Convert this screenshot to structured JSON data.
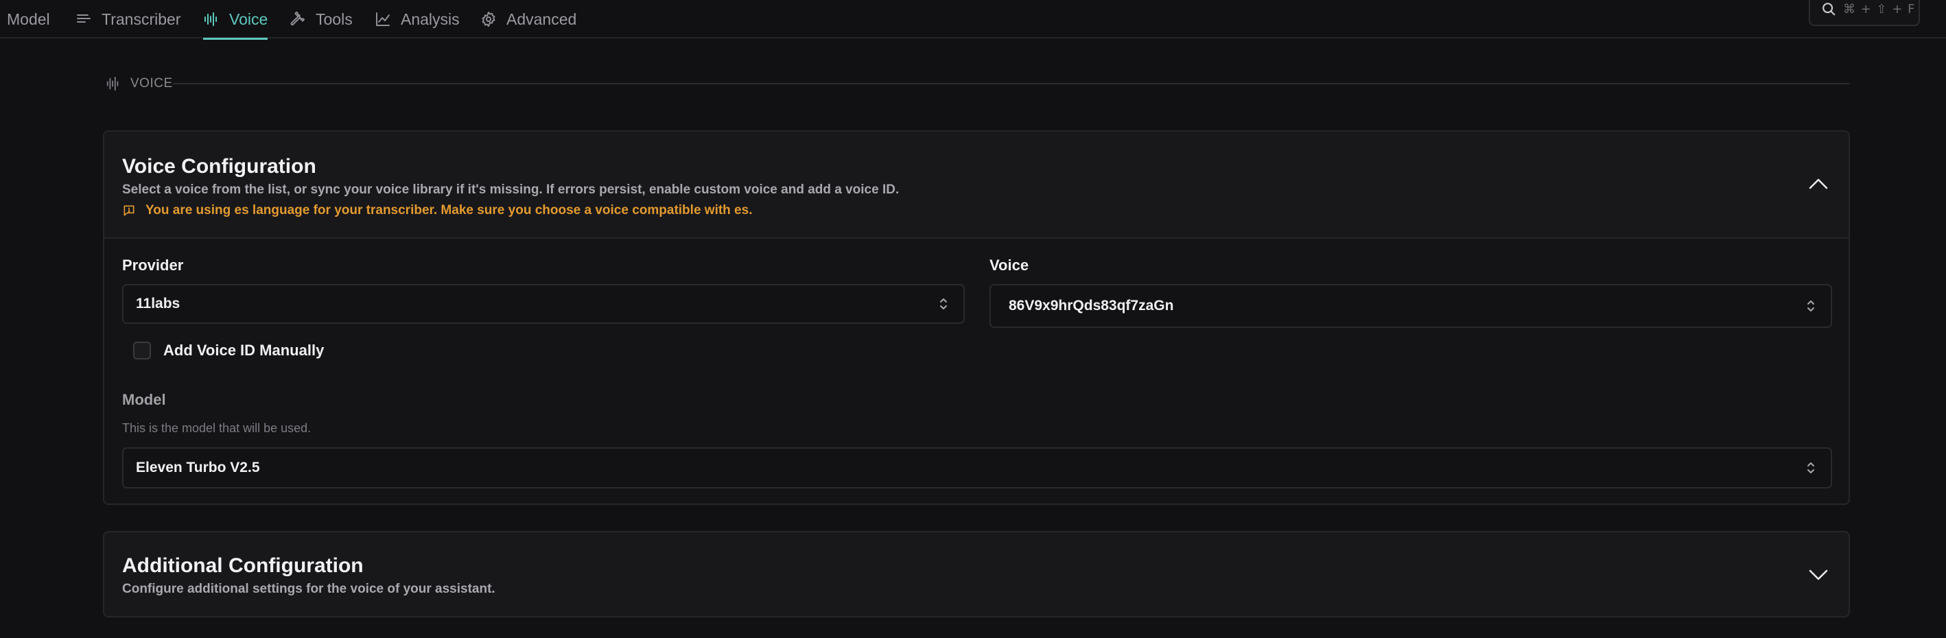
{
  "tabs": [
    {
      "id": "model",
      "label": "Model",
      "icon": "none",
      "active": false
    },
    {
      "id": "transcriber",
      "label": "Transcriber",
      "icon": "lines-icon",
      "active": false
    },
    {
      "id": "voice",
      "label": "Voice",
      "icon": "waveform-icon",
      "active": true
    },
    {
      "id": "tools",
      "label": "Tools",
      "icon": "wrench-icon",
      "active": false
    },
    {
      "id": "analysis",
      "label": "Analysis",
      "icon": "chart-line-icon",
      "active": false
    },
    {
      "id": "advanced",
      "label": "Advanced",
      "icon": "gear-icon",
      "active": false
    }
  ],
  "search": {
    "shortcut": "⌘ + ⇧ + F",
    "icon": "search-icon"
  },
  "section": {
    "label": "VOICE",
    "icon": "waveform-icon"
  },
  "voice_config": {
    "title": "Voice Configuration",
    "description": "Select a voice from the list, or sync your voice library if it's missing. If errors persist, enable custom voice and add a voice ID.",
    "warning": "You are using es language for your transcriber. Make sure you choose a voice compatible with es.",
    "warning_icon": "message-alert-icon",
    "expanded": true,
    "provider_label": "Provider",
    "provider_value": "11labs",
    "voice_label": "Voice",
    "voice_value": "86V9x9hrQds83qf7zaGn",
    "manual_voice_label": "Add Voice ID Manually",
    "manual_voice_checked": false,
    "model_label": "Model",
    "model_help": "This is the model that will be used.",
    "model_value": "Eleven Turbo V2.5"
  },
  "additional_config": {
    "title": "Additional Configuration",
    "description": "Configure additional settings for the voice of your assistant.",
    "expanded": false
  },
  "colors": {
    "background": "#111113",
    "accent": "#5ec8be",
    "warning": "#e39a2f",
    "card": "#141416"
  }
}
